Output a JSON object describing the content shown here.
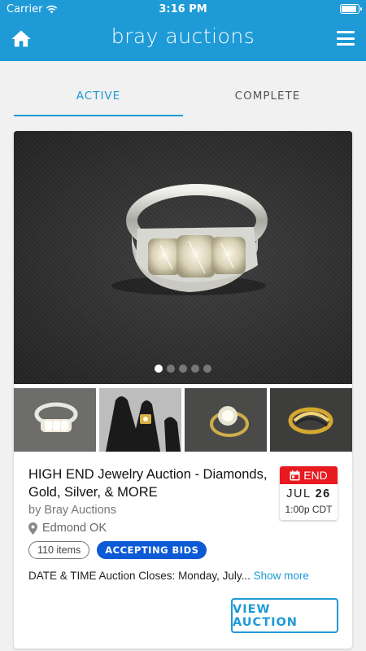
{
  "status_bar": {
    "carrier": "Carrier",
    "time": "3:16 PM"
  },
  "header": {
    "brand": "bray auctions",
    "home_icon": "home-icon",
    "menu_icon": "hamburger-menu-icon"
  },
  "tabs": [
    {
      "label": "ACTIVE",
      "active": true
    },
    {
      "label": "COMPLETE",
      "active": false
    }
  ],
  "auction": {
    "carousel": {
      "dot_count": 5,
      "active_index": 0
    },
    "thumbnails": [
      "ring-thumbnail-1",
      "ring-thumbnail-2",
      "ring-thumbnail-3",
      "ring-thumbnail-4"
    ],
    "title": "HIGH END Jewelry Auction - Diamonds, Gold, Silver, & MORE",
    "seller": "by Bray Auctions",
    "location": "Edmond OK",
    "items_count": "110 items",
    "status": "ACCEPTING BIDS",
    "end": {
      "label": "END",
      "month": "JUL",
      "day": "26",
      "time": "1:00p CDT"
    },
    "description": "DATE & TIME Auction Closes: Monday, July...",
    "show_more": "Show more",
    "view_button": "VIEW AUCTION"
  },
  "colors": {
    "brand": "#1e9ad6",
    "end_red": "#e8191f",
    "status_blue": "#0c5ad6"
  }
}
